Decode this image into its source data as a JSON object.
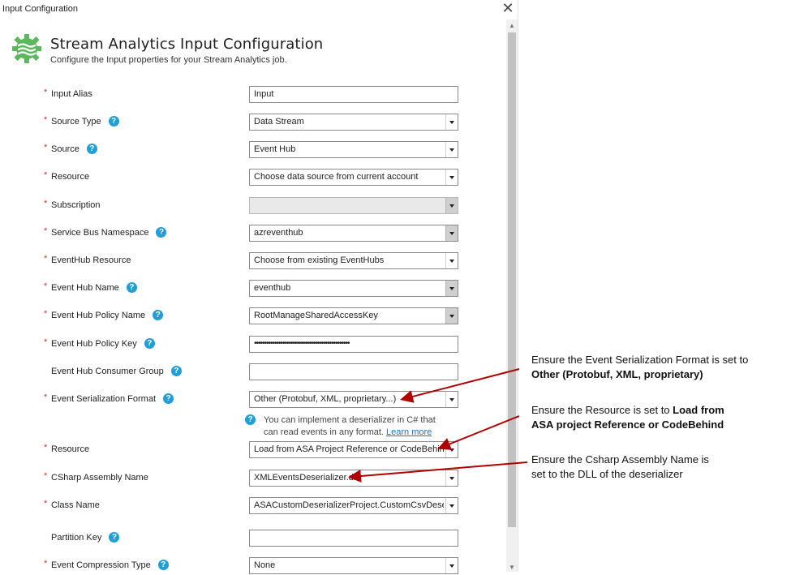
{
  "window": {
    "title": "Input Configuration",
    "close_glyph": "✕"
  },
  "header": {
    "title": "Stream Analytics Input Configuration",
    "subtitle": "Configure the Input properties for your Stream Analytics job."
  },
  "form": {
    "input_alias": {
      "label": "Input Alias",
      "value": "Input"
    },
    "source_type": {
      "label": "Source Type",
      "value": "Data Stream"
    },
    "source": {
      "label": "Source",
      "value": "Event Hub"
    },
    "resource": {
      "label": "Resource",
      "value": "Choose data source from current account"
    },
    "subscription": {
      "label": "Subscription",
      "value": ""
    },
    "service_bus_namespace": {
      "label": "Service Bus Namespace",
      "value": "azreventhub"
    },
    "eventhub_resource": {
      "label": "EventHub Resource",
      "value": "Choose from existing EventHubs"
    },
    "event_hub_name": {
      "label": "Event Hub Name",
      "value": "eventhub"
    },
    "event_hub_policy_name": {
      "label": "Event Hub Policy Name",
      "value": "RootManageSharedAccessKey"
    },
    "event_hub_policy_key": {
      "label": "Event Hub Policy Key",
      "value": "•••••••••••••••••••••••••••••••••••••••••••••••"
    },
    "consumer_group": {
      "label": "Event Hub Consumer Group",
      "value": ""
    },
    "serialization_format": {
      "label": "Event Serialization Format",
      "value": "Other (Protobuf, XML, proprietary...)"
    },
    "deserializer_info": {
      "text": "You can implement a deserializer in C# that can read events in any format.",
      "link": "Learn more"
    },
    "resource2": {
      "label": "Resource",
      "value": "Load from ASA Project Reference or CodeBehind"
    },
    "csharp_assembly_name": {
      "label": "CSharp Assembly Name",
      "value": "XMLEventsDeserializer.dll"
    },
    "class_name": {
      "label": "Class Name",
      "value": "ASACustomDeserializerProject.CustomCsvDeserializer"
    },
    "partition_key": {
      "label": "Partition Key",
      "value": ""
    },
    "compression_type": {
      "label": "Event Compression Type",
      "value": "None"
    }
  },
  "annotations": {
    "a1_line1": "Ensure the Event Serialization Format is set to",
    "a1_bold": "Other (Protobuf, XML, proprietary)",
    "a2_line1": "Ensure the Resource is set to ",
    "a2_bold1": "Load from",
    "a2_bold2": "ASA project Reference or CodeBehind",
    "a3_line1": "Ensure the Csharp Assembly Name is",
    "a3_line2": "set to the DLL of the deserializer"
  },
  "colors": {
    "arrow": "#b00000",
    "help_icon": "#1f9ed8",
    "required": "#c0392b",
    "logo": "#5cb85c"
  },
  "icons": {
    "help": "question-circle-icon",
    "logo": "gear-waves-icon",
    "dropdown": "chevron-down-icon"
  }
}
